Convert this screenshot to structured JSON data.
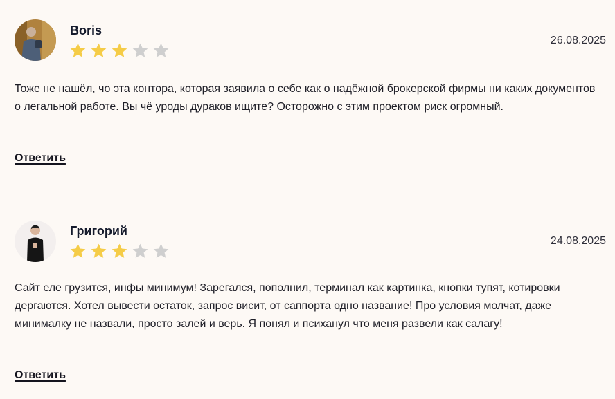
{
  "reviews": [
    {
      "author": "Boris",
      "date": "26.08.2025",
      "rating": 3,
      "rating_max": 5,
      "text": "Тоже не нашёл, чо эта контора, которая заявила о себе как о надёжной брокерской фирмы ни каких документов о легальной работе. Вы чё уроды дураков ищите? Осторожно с этим проектом риск огромный.",
      "reply_label": "Ответить"
    },
    {
      "author": "Григорий",
      "date": "24.08.2025",
      "rating": 3,
      "rating_max": 5,
      "text": "Сайт еле грузится, инфы минимум! Зарегался, пополнил, терминал как картинка, кнопки тупят, котировки дергаются. Хотел вывести остаток, запрос висит, от саппорта одно название! Про условия молчат, даже минималку не назвали, просто залей и верь. Я понял и психанул что меня развели как салагу!",
      "reply_label": "Ответить"
    }
  ],
  "colors": {
    "star_filled": "#f5cc47",
    "star_empty": "#cfcfcf",
    "background": "#fdf9f5"
  }
}
